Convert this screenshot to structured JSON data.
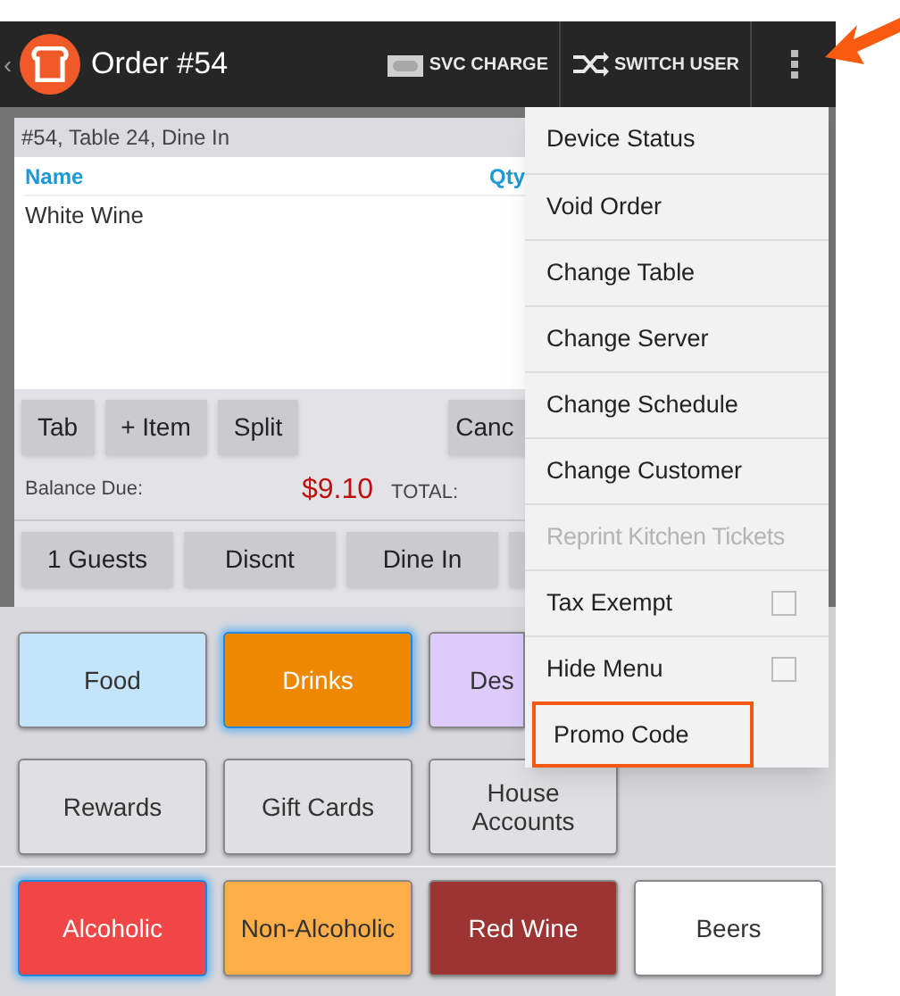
{
  "app_bar": {
    "back": "‹",
    "title": "Order #54",
    "actions": [
      {
        "label": "SVC CHARGE",
        "kind": "ticket"
      },
      {
        "label": "SWITCH USER",
        "kind": "shuffle"
      }
    ]
  },
  "order": {
    "header": "#54, Table 24, Dine In",
    "columns": [
      "Name",
      "Qty"
    ],
    "items": [
      {
        "name": "White Wine"
      }
    ],
    "actions": [
      "Tab",
      "+ Item",
      "Split",
      "Canc"
    ],
    "balance_label": "Balance Due:",
    "balance": "$9.10",
    "total_label": "TOTAL:",
    "options": [
      "1 Guests",
      "Discnt",
      "Dine In"
    ]
  },
  "categories": [
    {
      "label": "Food",
      "color": "#c4e4fb",
      "selected": false
    },
    {
      "label": "Drinks",
      "color": "#ee8800",
      "selected": true
    },
    {
      "label": "Des",
      "color": "#dccbfb",
      "selected": false
    },
    {
      "label": "Rewards",
      "color": "#e0e0e2",
      "selected": false
    },
    {
      "label": "Gift Cards",
      "color": "#e0e0e2",
      "selected": false
    },
    {
      "label": "House Accounts",
      "color": "#e0e0e2",
      "selected": false
    }
  ],
  "subcategories": [
    {
      "label": "Alcoholic",
      "color": "#f04646",
      "selected": true
    },
    {
      "label": "Non-Alcoholic",
      "color": "#fdae48",
      "selected": false
    },
    {
      "label": "Red Wine",
      "color": "#9c3434",
      "selected": false
    },
    {
      "label": "Beers",
      "color": "#ffffff",
      "selected": false
    }
  ],
  "menu": [
    {
      "label": "Device Status",
      "kind": "item",
      "disabled": false,
      "highlighted": false
    },
    {
      "label": "Void Order",
      "kind": "item",
      "disabled": false,
      "highlighted": false
    },
    {
      "label": "Change Table",
      "kind": "item",
      "disabled": false,
      "highlighted": false
    },
    {
      "label": "Change Server",
      "kind": "item",
      "disabled": false,
      "highlighted": false
    },
    {
      "label": "Change Schedule",
      "kind": "item",
      "disabled": false,
      "highlighted": false
    },
    {
      "label": "Change Customer",
      "kind": "item",
      "disabled": false,
      "highlighted": false
    },
    {
      "label": "Reprint Kitchen Tickets",
      "kind": "item",
      "disabled": true,
      "highlighted": false
    },
    {
      "label": "Tax Exempt",
      "kind": "checkbox",
      "checked": false,
      "disabled": false,
      "highlighted": false
    },
    {
      "label": "Hide Menu",
      "kind": "checkbox",
      "checked": false,
      "disabled": false,
      "highlighted": false
    },
    {
      "label": "Promo Code",
      "kind": "item",
      "disabled": false,
      "highlighted": true
    }
  ]
}
